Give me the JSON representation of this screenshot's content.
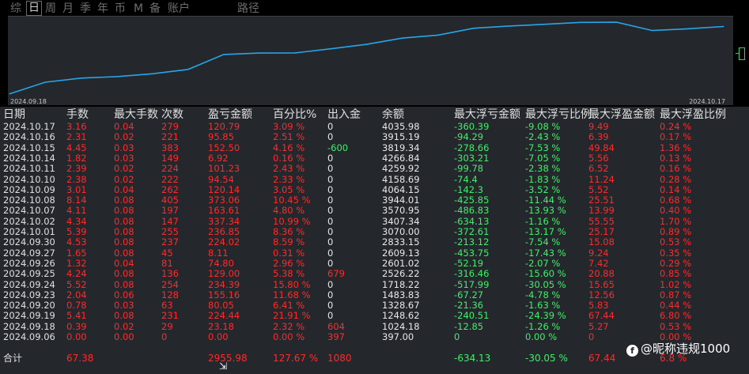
{
  "tabs": [
    {
      "label": "综",
      "active": false
    },
    {
      "label": "日",
      "active": true
    },
    {
      "label": "周",
      "active": false
    },
    {
      "label": "月",
      "active": false
    },
    {
      "label": "季",
      "active": false
    },
    {
      "label": "年",
      "active": false
    },
    {
      "label": "币",
      "active": false
    },
    {
      "label": "M",
      "active": false
    },
    {
      "label": "备",
      "active": false
    },
    {
      "label": "账户",
      "active": false
    },
    {
      "label": "路径",
      "active": false
    }
  ],
  "chart": {
    "date_start": "2024.09.18",
    "date_end": "2024.10.17",
    "line_color": "#26a6e8"
  },
  "chart_data": {
    "type": "line",
    "x": [
      "2024.09.06",
      "2024.09.18",
      "2024.09.19",
      "2024.09.20",
      "2024.09.23",
      "2024.09.24",
      "2024.09.25",
      "2024.09.26",
      "2024.09.27",
      "2024.09.30",
      "2024.10.01",
      "2024.10.02",
      "2024.10.07",
      "2024.10.08",
      "2024.10.09",
      "2024.10.10",
      "2024.10.11",
      "2024.10.14",
      "2024.10.15",
      "2024.10.16",
      "2024.10.17"
    ],
    "series": [
      {
        "values": [
          397.0,
          1024.18,
          1248.62,
          1328.67,
          1483.83,
          1718.22,
          2526.22,
          2601.02,
          2609.13,
          2833.15,
          3070.0,
          3407.34,
          3570.95,
          3944.01,
          4064.15,
          4158.69,
          4259.92,
          4266.84,
          3819.34,
          3915.19,
          4035.98
        ]
      }
    ]
  },
  "headers": [
    "日期",
    "手数",
    "最大手数",
    "次数",
    "盈亏金额",
    "百分比%",
    "出入金",
    "余额",
    "最大浮亏金额",
    "最大浮亏比例",
    "最大浮盈金额",
    "最大浮盈比例"
  ],
  "rows": [
    [
      "2024.10.17",
      "3.16",
      "0.04",
      "279",
      "120.79",
      "3.09 %",
      "0",
      "4035.98",
      "-360.39",
      "-9.08 %",
      "9.49",
      "0.24 %"
    ],
    [
      "2024.10.16",
      "2.31",
      "0.02",
      "221",
      "95.85",
      "2.51 %",
      "0",
      "3915.19",
      "-94.29",
      "-2.43 %",
      "6.39",
      "0.17 %"
    ],
    [
      "2024.10.15",
      "4.45",
      "0.03",
      "383",
      "152.50",
      "4.16 %",
      "-600",
      "3819.34",
      "-278.66",
      "-7.53 %",
      "49.84",
      "1.36 %"
    ],
    [
      "2024.10.14",
      "1.82",
      "0.03",
      "149",
      "6.92",
      "0.16 %",
      "0",
      "4266.84",
      "-303.21",
      "-7.05 %",
      "5.56",
      "0.13 %"
    ],
    [
      "2024.10.11",
      "2.39",
      "0.02",
      "224",
      "101.23",
      "2.43 %",
      "0",
      "4259.92",
      "-99.78",
      "-2.38 %",
      "6.52",
      "0.16 %"
    ],
    [
      "2024.10.10",
      "2.38",
      "0.02",
      "222",
      "94.54",
      "2.33 %",
      "0",
      "4158.69",
      "-74.4",
      "-1.83 %",
      "11.24",
      "0.28 %"
    ],
    [
      "2024.10.09",
      "3.01",
      "0.04",
      "262",
      "120.14",
      "3.05 %",
      "0",
      "4064.15",
      "-142.3",
      "-3.52 %",
      "5.52",
      "0.14 %"
    ],
    [
      "2024.10.08",
      "8.14",
      "0.08",
      "405",
      "373.06",
      "10.45 %",
      "0",
      "3944.01",
      "-425.85",
      "-11.44 %",
      "25.51",
      "0.68 %"
    ],
    [
      "2024.10.07",
      "4.11",
      "0.08",
      "197",
      "163.61",
      "4.80 %",
      "0",
      "3570.95",
      "-486.83",
      "-13.93 %",
      "13.99",
      "0.40 %"
    ],
    [
      "2024.10.02",
      "4.34",
      "0.08",
      "147",
      "337.34",
      "10.99 %",
      "0",
      "3407.34",
      "-634.13",
      "-1.16 %",
      "55.55",
      "1.70 %"
    ],
    [
      "2024.10.01",
      "5.39",
      "0.08",
      "255",
      "236.85",
      "8.36 %",
      "0",
      "3070.00",
      "-372.61",
      "-13.17 %",
      "25.17",
      "0.89 %"
    ],
    [
      "2024.09.30",
      "4.53",
      "0.08",
      "237",
      "224.02",
      "8.59 %",
      "0",
      "2833.15",
      "-213.12",
      "-7.54 %",
      "15.08",
      "0.53 %"
    ],
    [
      "2024.09.27",
      "1.65",
      "0.08",
      "45",
      "8.11",
      "0.31 %",
      "0",
      "2609.13",
      "-453.75",
      "-17.43 %",
      "9.24",
      "0.35 %"
    ],
    [
      "2024.09.26",
      "1.32",
      "0.04",
      "81",
      "74.80",
      "2.96 %",
      "0",
      "2601.02",
      "-52.19",
      "-2.07 %",
      "7.42",
      "0.29 %"
    ],
    [
      "2024.09.25",
      "4.24",
      "0.08",
      "136",
      "129.00",
      "5.38 %",
      "679",
      "2526.22",
      "-316.46",
      "-15.60 %",
      "20.88",
      "0.85 %"
    ],
    [
      "2024.09.24",
      "5.52",
      "0.08",
      "254",
      "234.39",
      "15.80 %",
      "0",
      "1718.22",
      "-517.99",
      "-30.05 %",
      "15.65",
      "1.02 %"
    ],
    [
      "2024.09.23",
      "2.04",
      "0.06",
      "128",
      "155.16",
      "11.68 %",
      "0",
      "1483.83",
      "-67.27",
      "-4.78 %",
      "12.56",
      "0.87 %"
    ],
    [
      "2024.09.20",
      "0.78",
      "0.03",
      "63",
      "80.05",
      "6.41 %",
      "0",
      "1328.67",
      "-21.36",
      "-1.63 %",
      "5.83",
      "0.44 %"
    ],
    [
      "2024.09.19",
      "5.41",
      "0.08",
      "231",
      "224.44",
      "21.91 %",
      "0",
      "1248.62",
      "-240.51",
      "-24.39 %",
      "67.44",
      "6.80 %"
    ],
    [
      "2024.09.18",
      "0.39",
      "0.02",
      "29",
      "23.18",
      "2.32 %",
      "604",
      "1024.18",
      "-12.85",
      "-1.26 %",
      "5.27",
      "0.53 %"
    ],
    [
      "2024.09.06",
      "0.00",
      "0.00",
      "0",
      "0.00",
      "0.00 %",
      "397",
      "397.00",
      "0",
      "0.00 %",
      "0",
      "0.00 %"
    ]
  ],
  "total": [
    "合计",
    "67.38",
    "",
    "",
    "2955.98",
    "127.67 %",
    "1080",
    "",
    "-634.13",
    "-30.05 %",
    "67.44",
    "6.8 %"
  ],
  "watermark": "@昵称违规1000"
}
